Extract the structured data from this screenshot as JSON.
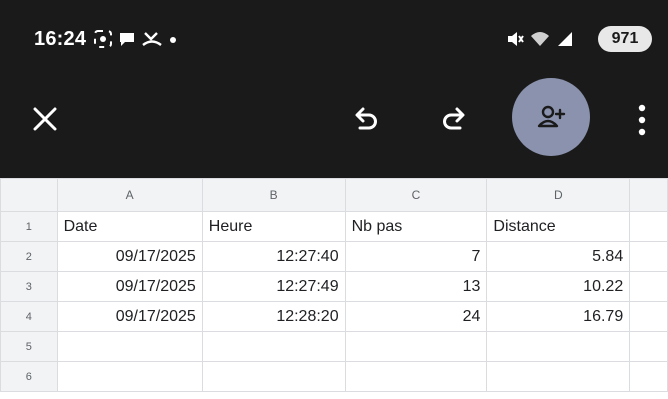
{
  "status_bar": {
    "time": "16:24",
    "battery": "971"
  },
  "toolbar": {
    "close": "close-icon",
    "undo": "undo-icon",
    "redo": "redo-icon",
    "share": "person-add-icon",
    "more": "more-vert-icon"
  },
  "sheet": {
    "columns": [
      "A",
      "B",
      "C",
      "D"
    ],
    "rows": [
      {
        "num": "1",
        "cells": [
          "Date",
          "Heure",
          "Nb pas",
          "Distance"
        ]
      },
      {
        "num": "2",
        "cells": [
          "09/17/2025",
          "12:27:40",
          "7",
          "5.84"
        ]
      },
      {
        "num": "3",
        "cells": [
          "09/17/2025",
          "12:27:49",
          "13",
          "10.22"
        ]
      },
      {
        "num": "4",
        "cells": [
          "09/17/2025",
          "12:28:20",
          "24",
          "16.79"
        ]
      },
      {
        "num": "5",
        "cells": [
          "",
          "",
          "",
          ""
        ]
      },
      {
        "num": "6",
        "cells": [
          "",
          "",
          "",
          ""
        ]
      }
    ]
  }
}
